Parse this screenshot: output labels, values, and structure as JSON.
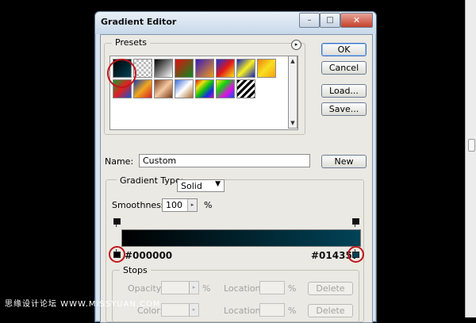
{
  "window": {
    "title": "Gradient Editor",
    "controls": {
      "minimize": "–",
      "maximize": "□",
      "close": "✕"
    }
  },
  "presets": {
    "legend": "Presets",
    "flyout_glyph": "▸",
    "scroll_up": "▲",
    "scroll_down": "▼",
    "swatches": [
      {
        "name": "black-teal",
        "fill": "linear-gradient(135deg,#000,#014357)"
      },
      {
        "name": "transparent",
        "fill": "repeating-conic-gradient(#bbb 0% 25%, #fff 0% 50%) 0 0 / 6px 6px"
      },
      {
        "name": "black-white",
        "fill": "linear-gradient(135deg,#000,#fff)"
      },
      {
        "name": "red-green",
        "fill": "linear-gradient(135deg,#e01010,#0b8a20)"
      },
      {
        "name": "violet-orange",
        "fill": "linear-gradient(135deg,#3a1abb,#f19a18)"
      },
      {
        "name": "blue-red-yellow",
        "fill": "linear-gradient(135deg,#1830d8,#e01818,#f8e818)"
      },
      {
        "name": "blue-yellow-blue",
        "fill": "linear-gradient(135deg,#1020c0,#f8f020,#1020c0)"
      },
      {
        "name": "orange-yellow",
        "fill": "linear-gradient(135deg,#f08010,#f8e020,#f8a010)"
      },
      {
        "name": "green-red",
        "fill": "linear-gradient(135deg,#1a9a30,#e02020,#1a4fd0)"
      },
      {
        "name": "copper-gold",
        "fill": "linear-gradient(135deg,#1a3aa8,#f0a820,#d82020)"
      },
      {
        "name": "copper",
        "fill": "linear-gradient(135deg,#7a3a18,#f4c8a0,#7a3a18)"
      },
      {
        "name": "chrome",
        "fill": "linear-gradient(135deg,#3a6ad8,#ffffff,#a86a2a)"
      },
      {
        "name": "spectrum",
        "fill": "linear-gradient(135deg,#e01010,#f0e010,#10c010,#1030e0,#c010c0)"
      },
      {
        "name": "rainbow",
        "fill": "linear-gradient(135deg,#f8f010,#10d010,#e010e0,#1050f0)"
      },
      {
        "name": "stripes",
        "fill": "repeating-linear-gradient(135deg,#000 0 3px,#fff 3px 6px)"
      }
    ]
  },
  "buttons": {
    "ok": "OK",
    "cancel": "Cancel",
    "load": "Load...",
    "save": "Save...",
    "new": "New",
    "delete_opacity": "Delete",
    "delete_color": "Delete"
  },
  "name_field": {
    "label": "Name:",
    "value": "Custom"
  },
  "gradient": {
    "type_label": "Gradient Type:",
    "type_value": "Solid",
    "smoothness_label": "Smoothness:",
    "smoothness_value": "100",
    "smoothness_unit": "%",
    "start_color": "#000000",
    "end_color": "#014357",
    "start_hex": "#000000",
    "end_hex": "#014357"
  },
  "stops": {
    "legend": "Stops",
    "opacity_label": "Opacity:",
    "opacity_unit": "%",
    "location_label_1": "Location:",
    "location_unit_1": "%",
    "color_label": "Color:",
    "location_label_2": "Location:",
    "location_unit_2": "%"
  },
  "watermark": "思缘设计论坛 WWW.MISSYUAN.COM"
}
